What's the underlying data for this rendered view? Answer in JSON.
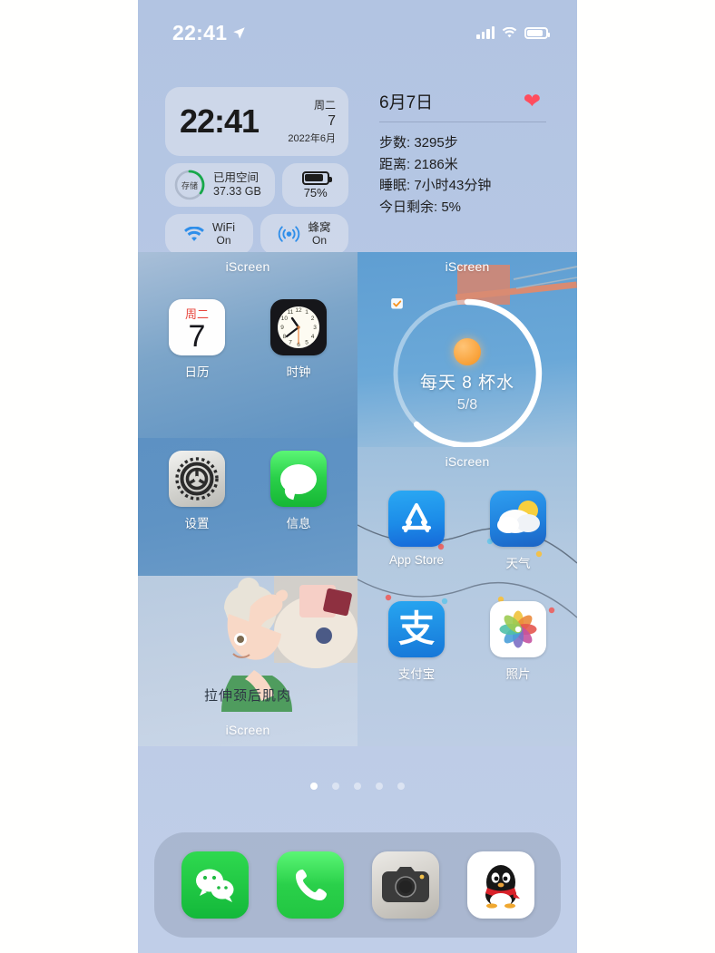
{
  "statusbar": {
    "time": "22:41",
    "location_icon": "location-arrow-icon",
    "cellular_icon": "cellular-bars-icon",
    "wifi_icon": "wifi-icon",
    "battery_icon": "battery-icon"
  },
  "widgets": {
    "clock": {
      "time": "22:41",
      "weekday": "周二",
      "day": "7",
      "yearmonth": "2022年6月"
    },
    "storage": {
      "ring_label": "存储",
      "title": "已用空间",
      "value": "37.33 GB",
      "ring_color": "#17a84a"
    },
    "battery": {
      "percent": "75%"
    },
    "wifi": {
      "label": "WiFi",
      "state": "On",
      "icon": "wifi-icon",
      "color": "#2e8eea"
    },
    "cellular": {
      "label": "蜂窝",
      "state": "On",
      "icon": "cellular-antenna-icon",
      "color": "#2e8eea"
    },
    "health": {
      "date": "6月7日",
      "heart_icon": "heart-icon",
      "heart_color": "#ff4d5e",
      "lines": [
        "步数: 3295步",
        "距离: 2186米",
        "睡眠: 7小时43分钟",
        "今日剩余: 5%"
      ]
    }
  },
  "grid": {
    "labels": {
      "top_left_iscreen": "iScreen",
      "top_right_iscreen": "iScreen",
      "mid_right_iscreen": "iScreen",
      "bottom_left_iscreen": "iScreen"
    },
    "apps": {
      "calendar": {
        "label": "日历",
        "weekday": "周二",
        "day": "7"
      },
      "clock": {
        "label": "时钟"
      },
      "settings": {
        "label": "设置"
      },
      "messages": {
        "label": "信息"
      },
      "appstore": {
        "label": "App Store"
      },
      "weather": {
        "label": "天气"
      },
      "alipay": {
        "label": "支付宝",
        "glyph": "支"
      },
      "photos": {
        "label": "照片"
      }
    },
    "water_widget": {
      "title": "每天 8 杯水",
      "count": "5/8",
      "icon": "water-check-icon",
      "progress": 0.625
    },
    "stretch_widget": {
      "caption": "拉伸颈后肌肉"
    }
  },
  "pagedots": {
    "total": 5,
    "active": 1
  },
  "dock": {
    "items": [
      {
        "name": "wechat-icon"
      },
      {
        "name": "phone-icon"
      },
      {
        "name": "camera-icon"
      },
      {
        "name": "qq-icon"
      }
    ]
  }
}
